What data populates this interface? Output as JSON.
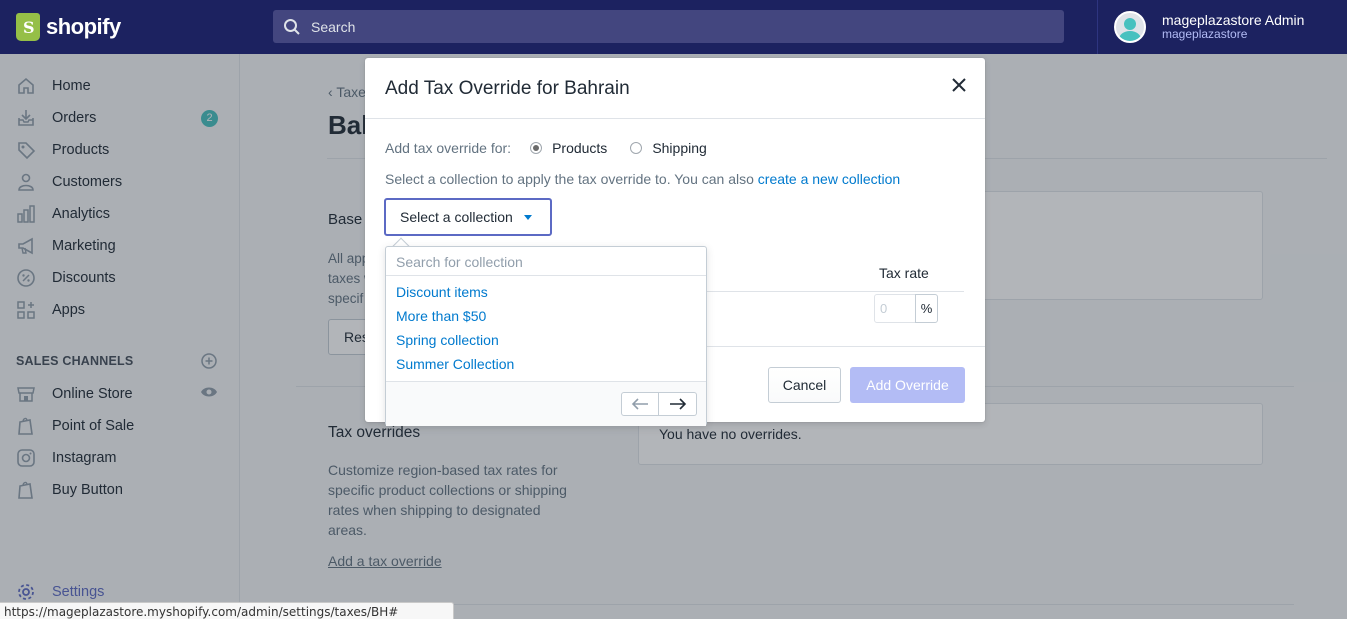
{
  "brand": {
    "name": "shopify"
  },
  "search": {
    "placeholder": "Search"
  },
  "user": {
    "name": "mageplazastore Admin",
    "store": "mageplazastore"
  },
  "sidebar": {
    "items": [
      {
        "label": "Home",
        "icon": "home-icon"
      },
      {
        "label": "Orders",
        "icon": "orders-icon",
        "badge": "2"
      },
      {
        "label": "Products",
        "icon": "tag-icon"
      },
      {
        "label": "Customers",
        "icon": "person-icon"
      },
      {
        "label": "Analytics",
        "icon": "bar-chart-icon"
      },
      {
        "label": "Marketing",
        "icon": "megaphone-icon"
      },
      {
        "label": "Discounts",
        "icon": "discount-icon"
      },
      {
        "label": "Apps",
        "icon": "apps-icon"
      }
    ],
    "channels_title": "SALES CHANNELS",
    "channels": [
      {
        "label": "Online Store",
        "icon": "store-icon"
      },
      {
        "label": "Point of Sale",
        "icon": "shopify-bag-icon"
      },
      {
        "label": "Instagram",
        "icon": "instagram-icon"
      },
      {
        "label": "Buy Button",
        "icon": "shopify-bag-icon"
      }
    ],
    "settings": "Settings"
  },
  "page": {
    "back_label": "Taxe",
    "title": "Bah",
    "base_title": "Base",
    "base_desc": "All app\ntaxes w\nspecif",
    "reset_label": "Res",
    "tax_overrides_title": "Tax overrides",
    "tax_overrides_desc": "Customize region-based tax rates for specific product collections or shipping rates when shipping to designated areas.",
    "add_override_link": "Add a tax override",
    "no_overrides": "You have no overrides."
  },
  "modal": {
    "title": "Add Tax Override for Bahrain",
    "for_label": "Add tax override for:",
    "option_products": "Products",
    "option_shipping": "Shipping",
    "selected_option": "Products",
    "hint_text": "Select a collection to apply the tax override to. You can also ",
    "hint_link": "create a new collection",
    "select_label": "Select a collection",
    "tax_rate_label": "Tax rate",
    "tax_rate_placeholder": "0",
    "percent": "%",
    "cancel": "Cancel",
    "add_override": "Add Override"
  },
  "popover": {
    "search_placeholder": "Search for collection",
    "items": [
      "Discount items",
      "More than $50",
      "Spring collection",
      "Summer Collection"
    ]
  },
  "status_url": "https://mageplazastore.myshopify.com/admin/settings/taxes/BH#",
  "colors": {
    "topbar": "#1c2260",
    "accent": "#5c6ac4",
    "link": "#007ace",
    "teal": "#47c1bf"
  }
}
